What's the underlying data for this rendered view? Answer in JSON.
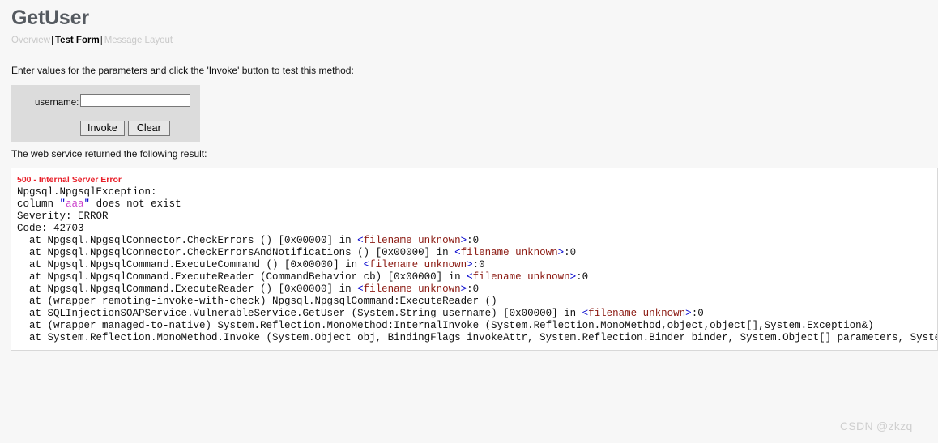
{
  "page": {
    "title": "GetUser",
    "instruction": "Enter values for the parameters and click the 'Invoke' button to test this method:",
    "result_caption": "The web service returned the following result:",
    "watermark": "CSDN @zkzq",
    "colors": {
      "page_background": "#f7f7f7",
      "title_text": "#555a60",
      "form_panel": "#dcdcdc",
      "error_red": "#e8202a",
      "token_punct": "#0000cc",
      "token_name": "#8b1a12",
      "token_value": "#cc44cc",
      "result_border": "#d8d8d8"
    }
  },
  "nav": {
    "separator": "|",
    "items": [
      {
        "label": "Overview",
        "active": false
      },
      {
        "label": "Test Form",
        "active": true
      },
      {
        "label": "Message Layout",
        "active": false
      }
    ]
  },
  "form": {
    "param_label": "username:",
    "param_value": "",
    "param_placeholder": "",
    "invoke_label": "Invoke",
    "clear_label": "Clear"
  },
  "result": {
    "status_line": "500 - Internal Server Error",
    "lines": [
      [
        {
          "t": "Npgsql.NpgsqlException:",
          "c": "plain"
        }
      ],
      [
        {
          "t": "column ",
          "c": "plain"
        },
        {
          "t": "\"",
          "c": "punct"
        },
        {
          "t": "aaa",
          "c": "val"
        },
        {
          "t": "\"",
          "c": "punct"
        },
        {
          "t": " does not exist",
          "c": "plain"
        }
      ],
      [
        {
          "t": "Severity: ERROR",
          "c": "plain"
        }
      ],
      [
        {
          "t": "Code: 42703",
          "c": "plain"
        }
      ],
      [
        {
          "t": "  at Npgsql.NpgsqlConnector.CheckErrors () [0x00000] in ",
          "c": "plain"
        },
        {
          "t": "<",
          "c": "punct"
        },
        {
          "t": "filename unknown",
          "c": "name"
        },
        {
          "t": ">",
          "c": "punct"
        },
        {
          "t": ":0",
          "c": "plain"
        }
      ],
      [
        {
          "t": "  at Npgsql.NpgsqlConnector.CheckErrorsAndNotifications () [0x00000] in ",
          "c": "plain"
        },
        {
          "t": "<",
          "c": "punct"
        },
        {
          "t": "filename unknown",
          "c": "name"
        },
        {
          "t": ">",
          "c": "punct"
        },
        {
          "t": ":0",
          "c": "plain"
        }
      ],
      [
        {
          "t": "  at Npgsql.NpgsqlCommand.ExecuteCommand () [0x00000] in ",
          "c": "plain"
        },
        {
          "t": "<",
          "c": "punct"
        },
        {
          "t": "filename unknown",
          "c": "name"
        },
        {
          "t": ">",
          "c": "punct"
        },
        {
          "t": ":0",
          "c": "plain"
        }
      ],
      [
        {
          "t": "  at Npgsql.NpgsqlCommand.ExecuteReader (CommandBehavior cb) [0x00000] in ",
          "c": "plain"
        },
        {
          "t": "<",
          "c": "punct"
        },
        {
          "t": "filename unknown",
          "c": "name"
        },
        {
          "t": ">",
          "c": "punct"
        },
        {
          "t": ":0",
          "c": "plain"
        }
      ],
      [
        {
          "t": "  at Npgsql.NpgsqlCommand.ExecuteReader () [0x00000] in ",
          "c": "plain"
        },
        {
          "t": "<",
          "c": "punct"
        },
        {
          "t": "filename unknown",
          "c": "name"
        },
        {
          "t": ">",
          "c": "punct"
        },
        {
          "t": ":0",
          "c": "plain"
        }
      ],
      [
        {
          "t": "  at (wrapper remoting-invoke-with-check) Npgsql.NpgsqlCommand:ExecuteReader ()",
          "c": "plain"
        }
      ],
      [
        {
          "t": "  at SQLInjectionSOAPService.VulnerableService.GetUser (System.String username) [0x00000] in ",
          "c": "plain"
        },
        {
          "t": "<",
          "c": "punct"
        },
        {
          "t": "filename unknown",
          "c": "name"
        },
        {
          "t": ">",
          "c": "punct"
        },
        {
          "t": ":0",
          "c": "plain"
        }
      ],
      [
        {
          "t": "  at (wrapper managed-to-native) System.Reflection.MonoMethod:InternalInvoke (System.Reflection.MonoMethod,object,object[],System.Exception&)",
          "c": "plain"
        }
      ],
      [
        {
          "t": "  at System.Reflection.MonoMethod.Invoke (System.Object obj, BindingFlags invokeAttr, System.Reflection.Binder binder, System.Object[] parameters, System.Globalization.CultureInfo culture)",
          "c": "plain"
        }
      ]
    ]
  }
}
